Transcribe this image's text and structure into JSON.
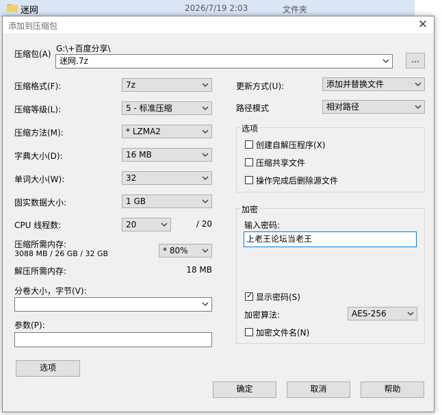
{
  "explorer": {
    "name": "迷网",
    "date": "2026/7/19 2:03",
    "type": "文件夹"
  },
  "dialog": {
    "title": "添加到压缩包",
    "close": "✕"
  },
  "archive": {
    "label": "压缩包(A)",
    "path": "G:\\+百度分享\\",
    "filename": "迷网.7z",
    "browse_label": "..."
  },
  "left": {
    "format": {
      "label": "压缩格式(F):",
      "value": "7z"
    },
    "level": {
      "label": "压缩等级(L):",
      "value": "5 - 标准压缩"
    },
    "method": {
      "label": "压缩方法(M):",
      "value": "* LZMA2"
    },
    "dict": {
      "label": "字典大小(D):",
      "value": "16 MB"
    },
    "word": {
      "label": "单词大小(W):",
      "value": "32"
    },
    "solid": {
      "label": "固实数据大小:",
      "value": "1 GB"
    },
    "threads": {
      "label": "CPU 线程数:",
      "value": "20",
      "total": "/ 20"
    },
    "mem_compress": {
      "label": "压缩所需内存:",
      "detail": "3088 MB / 26 GB / 32 GB",
      "value": "* 80%"
    },
    "mem_decompress": {
      "label": "解压所需内存:",
      "value": "18 MB"
    },
    "volume": {
      "label": "分卷大小，字节(V):",
      "value": ""
    },
    "params": {
      "label": "参数(P):",
      "value": ""
    },
    "options_button": "选项"
  },
  "right": {
    "update": {
      "label": "更新方式(U):",
      "value": "添加并替换文件"
    },
    "path_mode": {
      "label": "路径模式",
      "value": "相对路径"
    },
    "options": {
      "title": "选项",
      "sfx": "创建自解压程序(X)",
      "shared": "压缩共享文件",
      "delete": "操作完成后删除源文件"
    },
    "encryption": {
      "title": "加密",
      "password_label": "输入密码:",
      "password_value": "上老王论坛当老王",
      "show_password": "显示密码(S)",
      "method_label": "加密算法:",
      "method_value": "AES-256",
      "encrypt_names": "加密文件名(N)"
    }
  },
  "buttons": {
    "ok": "确定",
    "cancel": "取消",
    "help": "帮助"
  }
}
